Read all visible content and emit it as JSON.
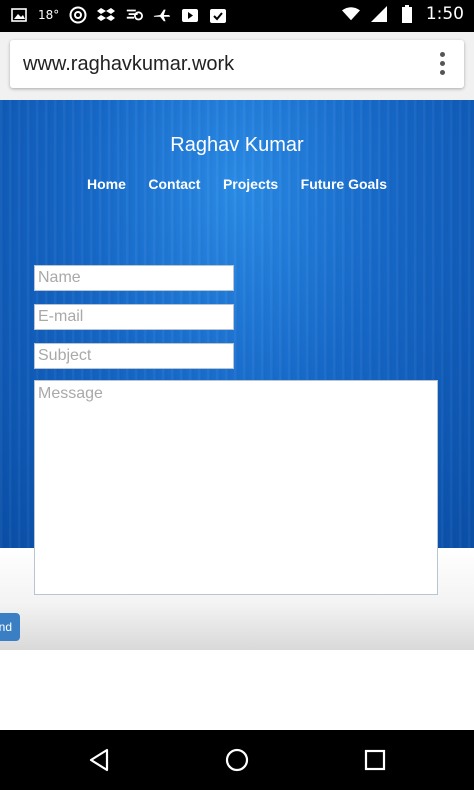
{
  "status_bar": {
    "temperature": "18°",
    "time": "1:50",
    "icons": [
      "image-icon",
      "temperature-icon",
      "circle-app-icon",
      "dropbox-icon",
      "signal-app-icon",
      "airplane-icon",
      "play-icon",
      "calendar-check-icon",
      "wifi-icon",
      "cell-signal-icon",
      "battery-icon"
    ]
  },
  "browser": {
    "url": "www.raghavkumar.work",
    "menu_icon": "overflow-menu-icon"
  },
  "site": {
    "title": "Raghav Kumar",
    "nav": [
      "Home",
      "Contact",
      "Projects",
      "Future Goals"
    ]
  },
  "form": {
    "name_placeholder": "Name",
    "email_placeholder": "E-mail",
    "subject_placeholder": "Subject",
    "message_placeholder": "Message",
    "send_label": "nd"
  },
  "system_nav": {
    "icons": [
      "back-icon",
      "home-icon",
      "recents-icon"
    ]
  },
  "colors": {
    "hero_blue": "#1668c8",
    "button_blue": "#3a7fc4"
  }
}
